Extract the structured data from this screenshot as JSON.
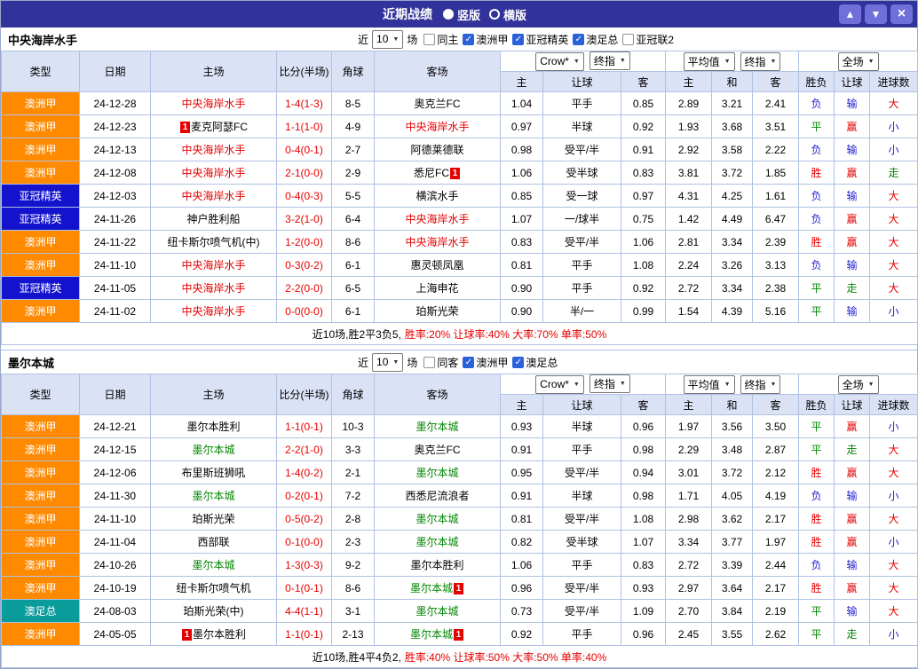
{
  "topbar": {
    "title": "近期战绩",
    "radios": [
      {
        "label": "竖版",
        "selected": true
      },
      {
        "label": "横版",
        "selected": false
      }
    ],
    "up_icon": "▲",
    "down_icon": "▼",
    "close_icon": "×"
  },
  "table_header": {
    "static_cols": [
      "类型",
      "日期",
      "主场",
      "比分(半场)",
      "角球",
      "客场"
    ],
    "odds_selects": [
      "Crow*",
      "终指"
    ],
    "avg_selects": [
      "平均值",
      "终指"
    ],
    "full_select": "全场",
    "odds_cols": [
      "主",
      "让球",
      "客"
    ],
    "avg_cols": [
      "主",
      "和",
      "客"
    ],
    "result_cols": [
      "胜负",
      "让球",
      "进球数"
    ]
  },
  "league_colors": {
    "澳洲甲": "#FF8A00",
    "亚冠精英": "#1313CE",
    "澳足总": "#0A9B9B"
  },
  "text_colors": {
    "red": "#E60000",
    "green": "#008600",
    "blue": "#2323CC",
    "black": "#000000"
  },
  "sections": [
    {
      "team": "中央海岸水手",
      "filter": {
        "prefix": "近",
        "count": "10",
        "suffix": "场",
        "checkboxes": [
          {
            "label": "同主",
            "checked": false
          },
          {
            "label": "澳洲甲",
            "checked": true
          },
          {
            "label": "亚冠精英",
            "checked": true
          },
          {
            "label": "澳足总",
            "checked": true
          },
          {
            "label": "亚冠联2",
            "checked": false
          }
        ]
      },
      "rows": [
        {
          "league": "澳洲甲",
          "date": "24-12-28",
          "home": {
            "name": "中央海岸水手",
            "color": "red"
          },
          "score": "1-4(1-3)",
          "corner": "8-5",
          "away": {
            "name": "奥克兰FC",
            "color": "black"
          },
          "odds": [
            "1.04",
            "平手",
            "0.85"
          ],
          "avg": [
            "2.89",
            "3.21",
            "2.41"
          ],
          "res": [
            [
              "负",
              "blue"
            ],
            [
              "输",
              "blue"
            ],
            [
              "大",
              "red"
            ]
          ]
        },
        {
          "league": "澳洲甲",
          "date": "24-12-23",
          "home": {
            "name": "麦克阿瑟FC",
            "color": "black",
            "badge_before": "1"
          },
          "score": "1-1(1-0)",
          "corner": "4-9",
          "away": {
            "name": "中央海岸水手",
            "color": "red"
          },
          "odds": [
            "0.97",
            "半球",
            "0.92"
          ],
          "avg": [
            "1.93",
            "3.68",
            "3.51"
          ],
          "res": [
            [
              "平",
              "green"
            ],
            [
              "赢",
              "red"
            ],
            [
              "小",
              "blue"
            ]
          ]
        },
        {
          "league": "澳洲甲",
          "date": "24-12-13",
          "home": {
            "name": "中央海岸水手",
            "color": "red"
          },
          "score": "0-4(0-1)",
          "corner": "2-7",
          "away": {
            "name": "阿德莱德联",
            "color": "black"
          },
          "odds": [
            "0.98",
            "受平/半",
            "0.91"
          ],
          "avg": [
            "2.92",
            "3.58",
            "2.22"
          ],
          "res": [
            [
              "负",
              "blue"
            ],
            [
              "输",
              "blue"
            ],
            [
              "小",
              "blue"
            ]
          ]
        },
        {
          "league": "澳洲甲",
          "date": "24-12-08",
          "home": {
            "name": "中央海岸水手",
            "color": "red"
          },
          "score": "2-1(0-0)",
          "corner": "2-9",
          "away": {
            "name": "悉尼FC",
            "color": "black",
            "badge_after": "1"
          },
          "odds": [
            "1.06",
            "受半球",
            "0.83"
          ],
          "avg": [
            "3.81",
            "3.72",
            "1.85"
          ],
          "res": [
            [
              "胜",
              "red"
            ],
            [
              "赢",
              "red"
            ],
            [
              "走",
              "green"
            ]
          ]
        },
        {
          "league": "亚冠精英",
          "date": "24-12-03",
          "home": {
            "name": "中央海岸水手",
            "color": "red"
          },
          "score": "0-4(0-3)",
          "corner": "5-5",
          "away": {
            "name": "横滨水手",
            "color": "black"
          },
          "odds": [
            "0.85",
            "受一球",
            "0.97"
          ],
          "avg": [
            "4.31",
            "4.25",
            "1.61"
          ],
          "res": [
            [
              "负",
              "blue"
            ],
            [
              "输",
              "blue"
            ],
            [
              "大",
              "red"
            ]
          ]
        },
        {
          "league": "亚冠精英",
          "date": "24-11-26",
          "home": {
            "name": "神户胜利船",
            "color": "black"
          },
          "score": "3-2(1-0)",
          "corner": "6-4",
          "away": {
            "name": "中央海岸水手",
            "color": "red"
          },
          "odds": [
            "1.07",
            "一/球半",
            "0.75"
          ],
          "avg": [
            "1.42",
            "4.49",
            "6.47"
          ],
          "res": [
            [
              "负",
              "blue"
            ],
            [
              "赢",
              "red"
            ],
            [
              "大",
              "red"
            ]
          ]
        },
        {
          "league": "澳洲甲",
          "date": "24-11-22",
          "home": {
            "name": "纽卡斯尔喷气机(中)",
            "color": "black"
          },
          "score": "1-2(0-0)",
          "corner": "8-6",
          "away": {
            "name": "中央海岸水手",
            "color": "red"
          },
          "odds": [
            "0.83",
            "受平/半",
            "1.06"
          ],
          "avg": [
            "2.81",
            "3.34",
            "2.39"
          ],
          "res": [
            [
              "胜",
              "red"
            ],
            [
              "赢",
              "red"
            ],
            [
              "大",
              "red"
            ]
          ]
        },
        {
          "league": "澳洲甲",
          "date": "24-11-10",
          "home": {
            "name": "中央海岸水手",
            "color": "red"
          },
          "score": "0-3(0-2)",
          "corner": "6-1",
          "away": {
            "name": "惠灵顿凤凰",
            "color": "black"
          },
          "odds": [
            "0.81",
            "平手",
            "1.08"
          ],
          "avg": [
            "2.24",
            "3.26",
            "3.13"
          ],
          "res": [
            [
              "负",
              "blue"
            ],
            [
              "输",
              "blue"
            ],
            [
              "大",
              "red"
            ]
          ]
        },
        {
          "league": "亚冠精英",
          "date": "24-11-05",
          "home": {
            "name": "中央海岸水手",
            "color": "red"
          },
          "score": "2-2(0-0)",
          "corner": "6-5",
          "away": {
            "name": "上海申花",
            "color": "black"
          },
          "odds": [
            "0.90",
            "平手",
            "0.92"
          ],
          "avg": [
            "2.72",
            "3.34",
            "2.38"
          ],
          "res": [
            [
              "平",
              "green"
            ],
            [
              "走",
              "green"
            ],
            [
              "大",
              "red"
            ]
          ]
        },
        {
          "league": "澳洲甲",
          "date": "24-11-02",
          "home": {
            "name": "中央海岸水手",
            "color": "red"
          },
          "score": "0-0(0-0)",
          "corner": "6-1",
          "away": {
            "name": "珀斯光荣",
            "color": "black"
          },
          "odds": [
            "0.90",
            "半/一",
            "0.99"
          ],
          "avg": [
            "1.54",
            "4.39",
            "5.16"
          ],
          "res": [
            [
              "平",
              "green"
            ],
            [
              "输",
              "blue"
            ],
            [
              "小",
              "blue"
            ]
          ]
        }
      ],
      "summary_prefix": "近10场,胜2平3负5,",
      "summary_stats": "胜率:20% 让球率:40% 大率:70% 单率:50%"
    },
    {
      "team": "墨尔本城",
      "filter": {
        "prefix": "近",
        "count": "10",
        "suffix": "场",
        "checkboxes": [
          {
            "label": "同客",
            "checked": false
          },
          {
            "label": "澳洲甲",
            "checked": true
          },
          {
            "label": "澳足总",
            "checked": true
          }
        ]
      },
      "rows": [
        {
          "league": "澳洲甲",
          "date": "24-12-21",
          "home": {
            "name": "墨尔本胜利",
            "color": "black"
          },
          "score": "1-1(0-1)",
          "corner": "10-3",
          "away": {
            "name": "墨尔本城",
            "color": "green"
          },
          "odds": [
            "0.93",
            "半球",
            "0.96"
          ],
          "avg": [
            "1.97",
            "3.56",
            "3.50"
          ],
          "res": [
            [
              "平",
              "green"
            ],
            [
              "赢",
              "red"
            ],
            [
              "小",
              "blue"
            ]
          ]
        },
        {
          "league": "澳洲甲",
          "date": "24-12-15",
          "home": {
            "name": "墨尔本城",
            "color": "green"
          },
          "score": "2-2(1-0)",
          "corner": "3-3",
          "away": {
            "name": "奥克兰FC",
            "color": "black"
          },
          "odds": [
            "0.91",
            "平手",
            "0.98"
          ],
          "avg": [
            "2.29",
            "3.48",
            "2.87"
          ],
          "res": [
            [
              "平",
              "green"
            ],
            [
              "走",
              "green"
            ],
            [
              "大",
              "red"
            ]
          ]
        },
        {
          "league": "澳洲甲",
          "date": "24-12-06",
          "home": {
            "name": "布里斯班狮吼",
            "color": "black"
          },
          "score": "1-4(0-2)",
          "corner": "2-1",
          "away": {
            "name": "墨尔本城",
            "color": "green"
          },
          "odds": [
            "0.95",
            "受平/半",
            "0.94"
          ],
          "avg": [
            "3.01",
            "3.72",
            "2.12"
          ],
          "res": [
            [
              "胜",
              "red"
            ],
            [
              "赢",
              "red"
            ],
            [
              "大",
              "red"
            ]
          ]
        },
        {
          "league": "澳洲甲",
          "date": "24-11-30",
          "home": {
            "name": "墨尔本城",
            "color": "green"
          },
          "score": "0-2(0-1)",
          "corner": "7-2",
          "away": {
            "name": "西悉尼流浪者",
            "color": "black"
          },
          "odds": [
            "0.91",
            "半球",
            "0.98"
          ],
          "avg": [
            "1.71",
            "4.05",
            "4.19"
          ],
          "res": [
            [
              "负",
              "blue"
            ],
            [
              "输",
              "blue"
            ],
            [
              "小",
              "blue"
            ]
          ]
        },
        {
          "league": "澳洲甲",
          "date": "24-11-10",
          "home": {
            "name": "珀斯光荣",
            "color": "black"
          },
          "score": "0-5(0-2)",
          "corner": "2-8",
          "away": {
            "name": "墨尔本城",
            "color": "green"
          },
          "odds": [
            "0.81",
            "受平/半",
            "1.08"
          ],
          "avg": [
            "2.98",
            "3.62",
            "2.17"
          ],
          "res": [
            [
              "胜",
              "red"
            ],
            [
              "赢",
              "red"
            ],
            [
              "大",
              "red"
            ]
          ]
        },
        {
          "league": "澳洲甲",
          "date": "24-11-04",
          "home": {
            "name": "西部联",
            "color": "black"
          },
          "score": "0-1(0-0)",
          "corner": "2-3",
          "away": {
            "name": "墨尔本城",
            "color": "green"
          },
          "odds": [
            "0.82",
            "受半球",
            "1.07"
          ],
          "avg": [
            "3.34",
            "3.77",
            "1.97"
          ],
          "res": [
            [
              "胜",
              "red"
            ],
            [
              "赢",
              "red"
            ],
            [
              "小",
              "blue"
            ]
          ]
        },
        {
          "league": "澳洲甲",
          "date": "24-10-26",
          "home": {
            "name": "墨尔本城",
            "color": "green"
          },
          "score": "1-3(0-3)",
          "corner": "9-2",
          "away": {
            "name": "墨尔本胜利",
            "color": "black"
          },
          "odds": [
            "1.06",
            "平手",
            "0.83"
          ],
          "avg": [
            "2.72",
            "3.39",
            "2.44"
          ],
          "res": [
            [
              "负",
              "blue"
            ],
            [
              "输",
              "blue"
            ],
            [
              "大",
              "red"
            ]
          ]
        },
        {
          "league": "澳洲甲",
          "date": "24-10-19",
          "home": {
            "name": "纽卡斯尔喷气机",
            "color": "black"
          },
          "score": "0-1(0-1)",
          "corner": "8-6",
          "away": {
            "name": "墨尔本城",
            "color": "green",
            "badge_after": "1"
          },
          "odds": [
            "0.96",
            "受平/半",
            "0.93"
          ],
          "avg": [
            "2.97",
            "3.64",
            "2.17"
          ],
          "res": [
            [
              "胜",
              "red"
            ],
            [
              "赢",
              "red"
            ],
            [
              "大",
              "red"
            ]
          ]
        },
        {
          "league": "澳足总",
          "date": "24-08-03",
          "home": {
            "name": "珀斯光荣(中)",
            "color": "black"
          },
          "score": "4-4(1-1)",
          "corner": "3-1",
          "away": {
            "name": "墨尔本城",
            "color": "green"
          },
          "odds": [
            "0.73",
            "受平/半",
            "1.09"
          ],
          "avg": [
            "2.70",
            "3.84",
            "2.19"
          ],
          "res": [
            [
              "平",
              "green"
            ],
            [
              "输",
              "blue"
            ],
            [
              "大",
              "red"
            ]
          ]
        },
        {
          "league": "澳洲甲",
          "date": "24-05-05",
          "home": {
            "name": "墨尔本胜利",
            "color": "black",
            "badge_before": "1"
          },
          "score": "1-1(0-1)",
          "corner": "2-13",
          "away": {
            "name": "墨尔本城",
            "color": "green",
            "badge_after": "1"
          },
          "odds": [
            "0.92",
            "平手",
            "0.96"
          ],
          "avg": [
            "2.45",
            "3.55",
            "2.62"
          ],
          "res": [
            [
              "平",
              "green"
            ],
            [
              "走",
              "green"
            ],
            [
              "小",
              "blue"
            ]
          ]
        }
      ],
      "summary_prefix": "近10场,胜4平4负2,",
      "summary_stats": "胜率:40% 让球率:50% 大率:50% 单率:40%"
    }
  ]
}
